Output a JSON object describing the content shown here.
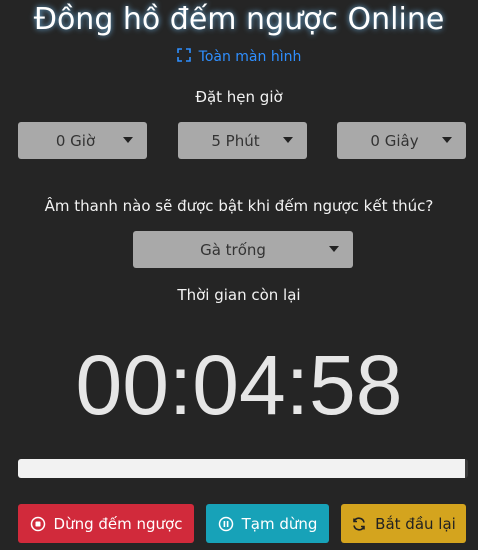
{
  "title": "Đồng hồ đếm ngược Online",
  "fullscreen_label": "Toàn màn hình",
  "set_time_label": "Đặt hẹn giờ",
  "selects": {
    "hours": "0 Giờ",
    "minutes": "5 Phút",
    "seconds": "0 Giây"
  },
  "sound_question": "Âm thanh nào sẽ được bật khi đếm ngược kết thúc?",
  "sound_selected": "Gà trống",
  "remaining_label": "Thời gian còn lại",
  "timer_display": "00:04:58",
  "progress_fraction": 0.993,
  "buttons": {
    "stop": "Dừng đếm ngược",
    "pause": "Tạm dừng",
    "restart": "Bắt đầu lại"
  },
  "colors": {
    "background": "#252525",
    "stop": "#d12a3b",
    "pause": "#17a2b8",
    "restart": "#d4a41e",
    "link": "#2f8fff"
  }
}
